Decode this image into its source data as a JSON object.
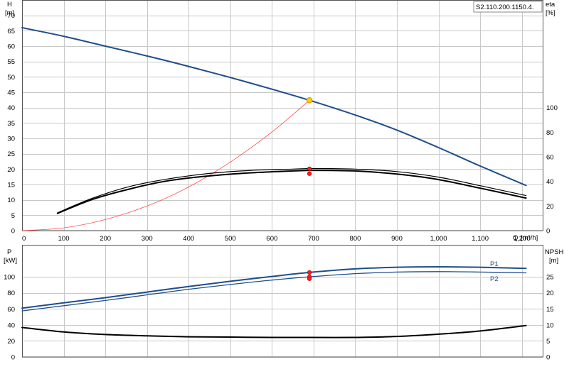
{
  "model_label": "S2.110.200.1150.4.",
  "chart_data": [
    {
      "type": "line",
      "name": "head-efficiency",
      "ylabel_left": "H",
      "yunit_left": "[m]",
      "ylabel_right": "eta",
      "yunit_right": "[%]",
      "xlabel": "Q",
      "xunit": "[m³/h]",
      "xlim": [
        0,
        1250
      ],
      "ylim_left": [
        0,
        75
      ],
      "ylim_right": [
        0,
        187.5
      ],
      "x_ticks": [
        {
          "v": 0,
          "t": "0"
        },
        {
          "v": 100,
          "t": "100"
        },
        {
          "v": 200,
          "t": "200"
        },
        {
          "v": 300,
          "t": "300"
        },
        {
          "v": 400,
          "t": "400"
        },
        {
          "v": 500,
          "t": "500"
        },
        {
          "v": 600,
          "t": "600"
        },
        {
          "v": 700,
          "t": "700"
        },
        {
          "v": 800,
          "t": "800"
        },
        {
          "v": 900,
          "t": "900"
        },
        {
          "v": 1000,
          "t": "1,000"
        },
        {
          "v": 1100,
          "t": "1,100"
        },
        {
          "v": 1200,
          "t": "1,200"
        }
      ],
      "y_ticks_left": [
        "0",
        "5",
        "10",
        "15",
        "20",
        "25",
        "30",
        "35",
        "40",
        "45",
        "50",
        "55",
        "60",
        "65",
        "70"
      ],
      "y_ticks_right": [
        "0",
        "20",
        "40",
        "60",
        "80",
        "100"
      ],
      "grid": true,
      "series": [
        {
          "name": "H",
          "axis": "left",
          "color": "#1f4e8c",
          "width": 2,
          "x": [
            0,
            100,
            200,
            300,
            400,
            500,
            600,
            690,
            800,
            900,
            1000,
            1100,
            1210
          ],
          "y": [
            66,
            63.2,
            60,
            56.8,
            53.4,
            49.8,
            46,
            42.4,
            37.6,
            32.7,
            27,
            21,
            14.7
          ]
        },
        {
          "name": "System curve",
          "axis": "left",
          "color": "#ff4a4a",
          "width": 0.8,
          "x": [
            0,
            100,
            200,
            300,
            400,
            500,
            600,
            690
          ],
          "y": [
            0,
            0.9,
            3.6,
            8.0,
            14.2,
            22.3,
            32.1,
            42.4
          ]
        },
        {
          "name": "eta",
          "axis": "right",
          "color": "#000000",
          "width": 2,
          "x": [
            85,
            170,
            260,
            350,
            450,
            550,
            650,
            700,
            800,
            900,
            1000,
            1100,
            1210
          ],
          "y": [
            14,
            25.5,
            34,
            40.5,
            44.5,
            47,
            48.5,
            49,
            48.5,
            46,
            41.5,
            34.5,
            26.5
          ]
        },
        {
          "name": "eta total",
          "axis": "right",
          "color": "#000000",
          "width": 1.2,
          "x": [
            85,
            170,
            260,
            350,
            450,
            550,
            650,
            700,
            800,
            900,
            1000,
            1100,
            1210
          ],
          "y": [
            14.5,
            26.5,
            36,
            42,
            46.5,
            49,
            50,
            50.5,
            50,
            48,
            43.5,
            36.5,
            28.5
          ]
        }
      ],
      "points": [
        {
          "series": "H",
          "x": 690,
          "y": 42.4,
          "color": "#ffcc00",
          "stroke": "#d48a00",
          "r": 3.8
        },
        {
          "series": "eta",
          "x": 690,
          "y": 46.3,
          "color": "#ff2020",
          "stroke": "#cc0000",
          "r": 2.6
        },
        {
          "series": "eta total",
          "x": 690,
          "y": 50.3,
          "color": "#ff2020",
          "stroke": "#cc0000",
          "r": 2.6
        }
      ]
    },
    {
      "type": "line",
      "name": "power-npsh",
      "ylabel_left": "P",
      "yunit_left": "[kW]",
      "ylabel_right": "NPSH",
      "yunit_right": "[m]",
      "xlim": [
        0,
        1250
      ],
      "ylim_left": [
        0,
        140
      ],
      "ylim_right": [
        0,
        35
      ],
      "y_ticks_left": [
        "0",
        "20",
        "40",
        "60",
        "80",
        "100"
      ],
      "y_ticks_right": [
        "0",
        "5",
        "10",
        "15",
        "20",
        "25"
      ],
      "grid": true,
      "series": [
        {
          "name": "P1",
          "axis": "left",
          "color": "#1f4e8c",
          "width": 2,
          "x": [
            0,
            100,
            200,
            300,
            400,
            500,
            600,
            690,
            800,
            900,
            1000,
            1100,
            1210
          ],
          "y": [
            61,
            67.5,
            74,
            81,
            88,
            94.5,
            100.5,
            105.5,
            110,
            112,
            112.5,
            112,
            110.5
          ]
        },
        {
          "name": "P2",
          "axis": "left",
          "color": "#1f4e8c",
          "width": 1.3,
          "x": [
            0,
            100,
            200,
            300,
            400,
            500,
            600,
            690,
            800,
            900,
            1000,
            1100,
            1210
          ],
          "y": [
            57.5,
            64,
            70.5,
            77.5,
            84.5,
            90.5,
            96,
            100,
            104,
            106,
            106.5,
            106,
            105
          ]
        },
        {
          "name": "NPSH",
          "axis": "right",
          "color": "#000000",
          "width": 2,
          "x": [
            0,
            100,
            200,
            300,
            400,
            500,
            600,
            690,
            800,
            900,
            1000,
            1100,
            1210
          ],
          "y": [
            9.2,
            7.8,
            7,
            6.6,
            6.3,
            6.2,
            6.1,
            6.1,
            6.1,
            6.4,
            7.1,
            8.1,
            9.8
          ]
        }
      ],
      "points": [
        {
          "series": "P1",
          "x": 690,
          "y": 105.5,
          "color": "#ff2020",
          "stroke": "#cc0000",
          "r": 2.6
        },
        {
          "series": "P2",
          "x": 690,
          "y": 100,
          "color": "#ff2020",
          "stroke": "#cc0000",
          "r": 2.6
        },
        {
          "series": "NPSH",
          "x": 690,
          "y": 24.4,
          "color": "#ff2020",
          "stroke": "#cc0000",
          "r": 2.6
        }
      ],
      "series_labels": [
        {
          "text": "P1",
          "series": "P1",
          "color": "#1f4e8c"
        },
        {
          "text": "P2",
          "series": "P2",
          "color": "#1f4e8c"
        }
      ]
    }
  ]
}
